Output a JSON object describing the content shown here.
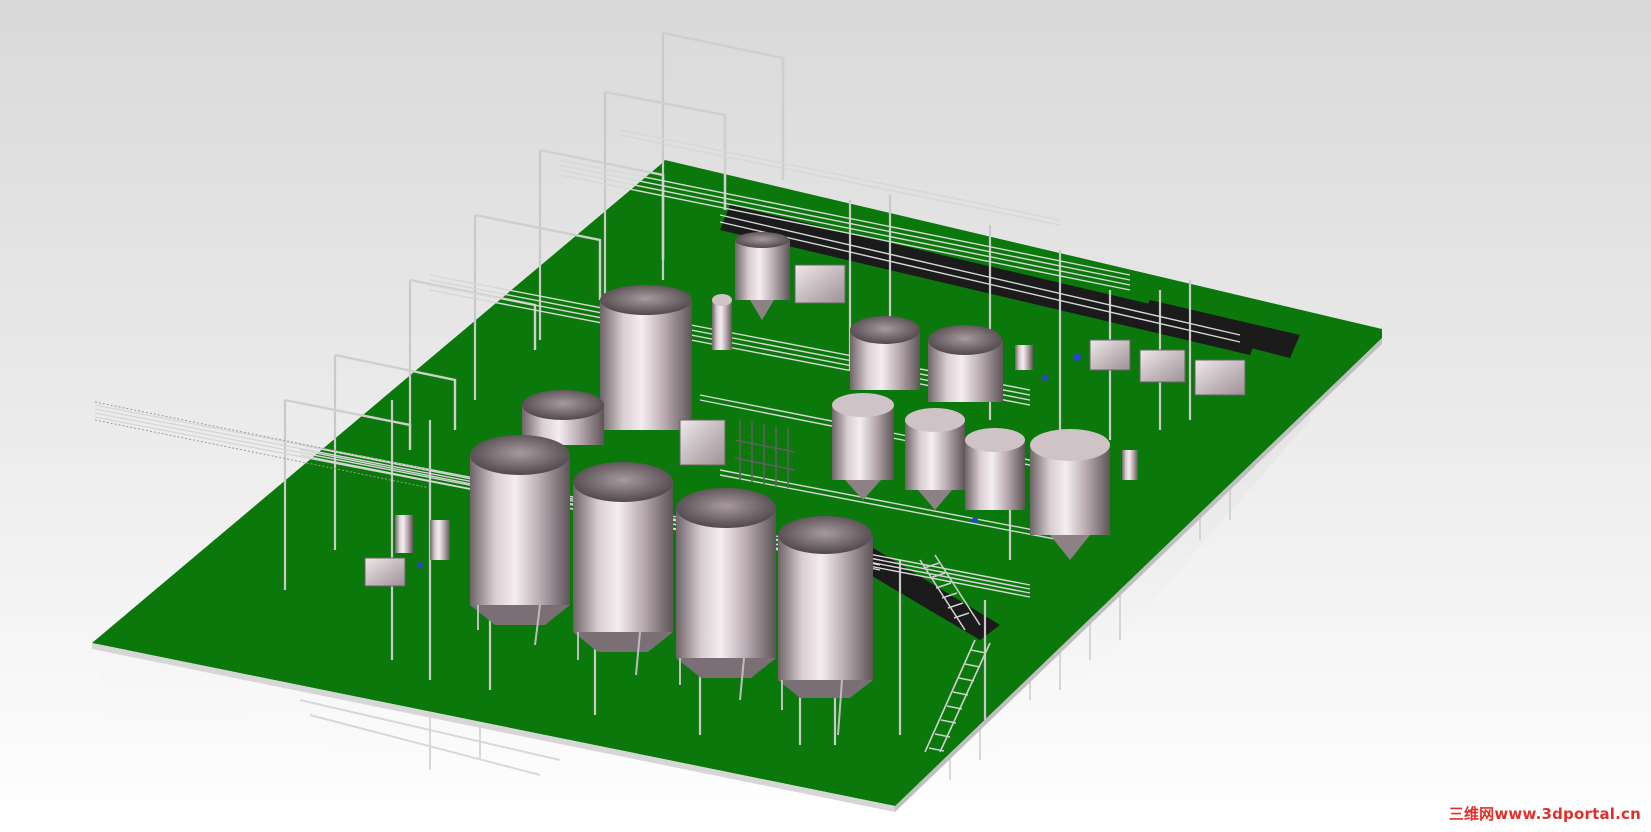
{
  "scene": {
    "subject": "3d-cad-model-of-processing-plant",
    "floor_color": "#0a7a0a",
    "tank_color": "#c8b8be",
    "pipe_color": "#c8c8c8"
  },
  "watermark": {
    "text": "三维网www.3dportal.cn",
    "color": "#e0302a"
  }
}
